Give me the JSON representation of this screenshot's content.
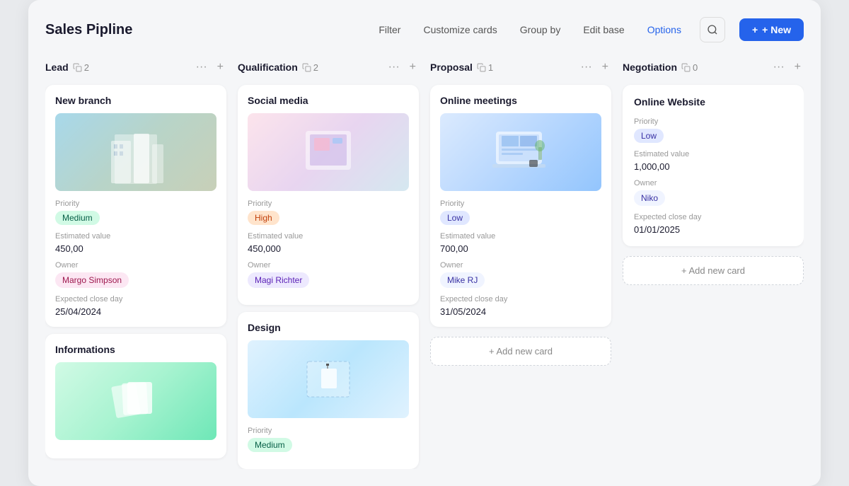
{
  "header": {
    "title": "Sales Pipline",
    "actions": [
      {
        "label": "Filter",
        "active": false
      },
      {
        "label": "Customize cards",
        "active": false
      },
      {
        "label": "Group by",
        "active": false
      },
      {
        "label": "Edit base",
        "active": false
      },
      {
        "label": "Options",
        "active": true
      }
    ],
    "search_icon": "🔍",
    "new_button": "+ New"
  },
  "columns": [
    {
      "id": "lead",
      "title": "Lead",
      "count": 2,
      "cards": [
        {
          "id": "new-branch",
          "title": "New branch",
          "image_type": "building",
          "priority_label": "Priority",
          "priority": "Medium",
          "priority_class": "medium",
          "estimated_label": "Estimated value",
          "estimated_value": "450,00",
          "owner_label": "Owner",
          "owner": "Margo Simpson",
          "owner_class": "pink",
          "close_label": "Expected close day",
          "close_date": "25/04/2024"
        },
        {
          "id": "informations",
          "title": "Informations",
          "image_type": "paper",
          "partial": true
        }
      ]
    },
    {
      "id": "qualification",
      "title": "Qualification",
      "count": 2,
      "cards": [
        {
          "id": "social-media",
          "title": "Social media",
          "image_type": "tablet",
          "priority_label": "Priority",
          "priority": "High",
          "priority_class": "high",
          "estimated_label": "Estimated value",
          "estimated_value": "450,000",
          "owner_label": "Owner",
          "owner": "Magi Richter",
          "owner_class": "purple",
          "close_label": null,
          "close_date": null
        },
        {
          "id": "design",
          "title": "Design",
          "image_type": "design",
          "priority_label": "Priority",
          "priority": "Medium",
          "priority_class": "medium",
          "partial": true
        }
      ]
    },
    {
      "id": "proposal",
      "title": "Proposal",
      "count": 1,
      "cards": [
        {
          "id": "online-meetings",
          "title": "Online meetings",
          "image_type": "laptop",
          "priority_label": "Priority",
          "priority": "Low",
          "priority_class": "low",
          "estimated_label": "Estimated value",
          "estimated_value": "700,00",
          "owner_label": "Owner",
          "owner": "Mike RJ",
          "owner_class": "blue",
          "close_label": "Expected close day",
          "close_date": "31/05/2024"
        }
      ],
      "add_card": "+ Add new card"
    },
    {
      "id": "negotiation",
      "title": "Negotiation",
      "count": 0,
      "negotiation_card": {
        "title": "Online Website",
        "priority_label": "Priority",
        "priority": "Low",
        "priority_class": "low",
        "estimated_label": "Estimated value",
        "estimated_value": "1,000,00",
        "owner_label": "Owner",
        "owner": "Niko",
        "owner_class": "blue",
        "close_label": "Expected close day",
        "close_date": "01/01/2025"
      },
      "add_card": "+ Add new card"
    }
  ],
  "icons": {
    "copy": "⎘",
    "more": "···",
    "plus": "+",
    "search": "○",
    "add": "+"
  }
}
